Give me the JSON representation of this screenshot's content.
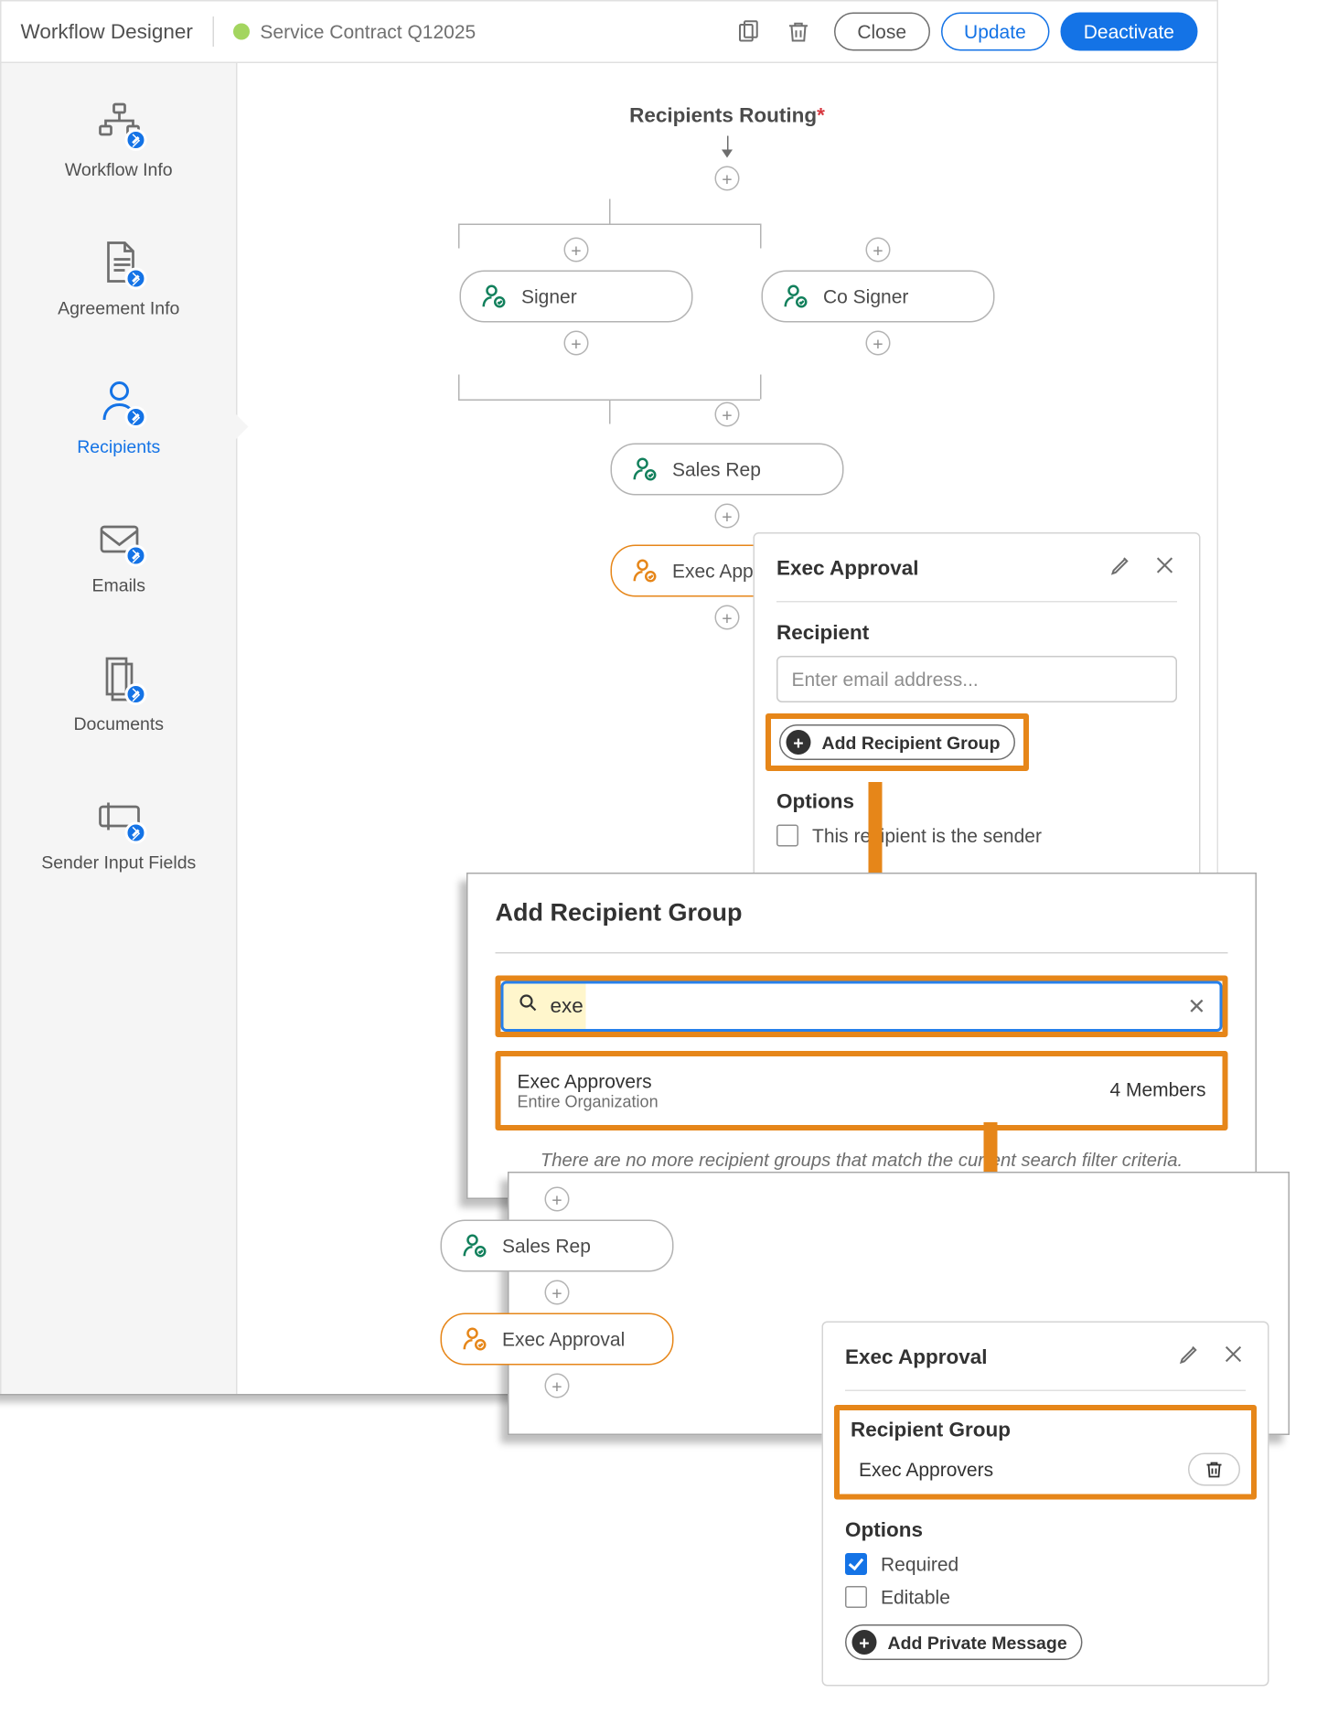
{
  "header": {
    "title": "Workflow Designer",
    "subtitle": "Service Contract Q12025",
    "close": "Close",
    "update": "Update",
    "deactivate": "Deactivate"
  },
  "sidebar": {
    "items": [
      {
        "label": "Workflow Info"
      },
      {
        "label": "Agreement Info"
      },
      {
        "label": "Recipients"
      },
      {
        "label": "Emails"
      },
      {
        "label": "Documents"
      },
      {
        "label": "Sender Input Fields"
      }
    ]
  },
  "canvas": {
    "title": "Recipients Routing",
    "roles": {
      "signer": "Signer",
      "cosigner": "Co Signer",
      "salesrep": "Sales Rep",
      "execapproval": "Exec Approval"
    }
  },
  "panel1": {
    "title": "Exec Approval",
    "recipient_label": "Recipient",
    "email_placeholder": "Enter email address...",
    "add_group": "Add Recipient Group",
    "options_label": "Options",
    "opt_sender": "This recipient is the sender"
  },
  "panel2": {
    "title": "Add Recipient Group",
    "search_value": "exe",
    "result_name": "Exec Approvers",
    "result_sub": "Entire Organization",
    "result_members": "4 Members",
    "no_more": "There are no more recipient groups that match the current search filter criteria."
  },
  "panel3": {
    "roles": {
      "salesrep": "Sales Rep",
      "execapproval": "Exec Approval"
    },
    "sp_title": "Exec Approval",
    "group_label": "Recipient Group",
    "group_value": "Exec Approvers",
    "options_label": "Options",
    "opt_required": "Required",
    "opt_editable": "Editable",
    "add_private": "Add Private Message"
  }
}
